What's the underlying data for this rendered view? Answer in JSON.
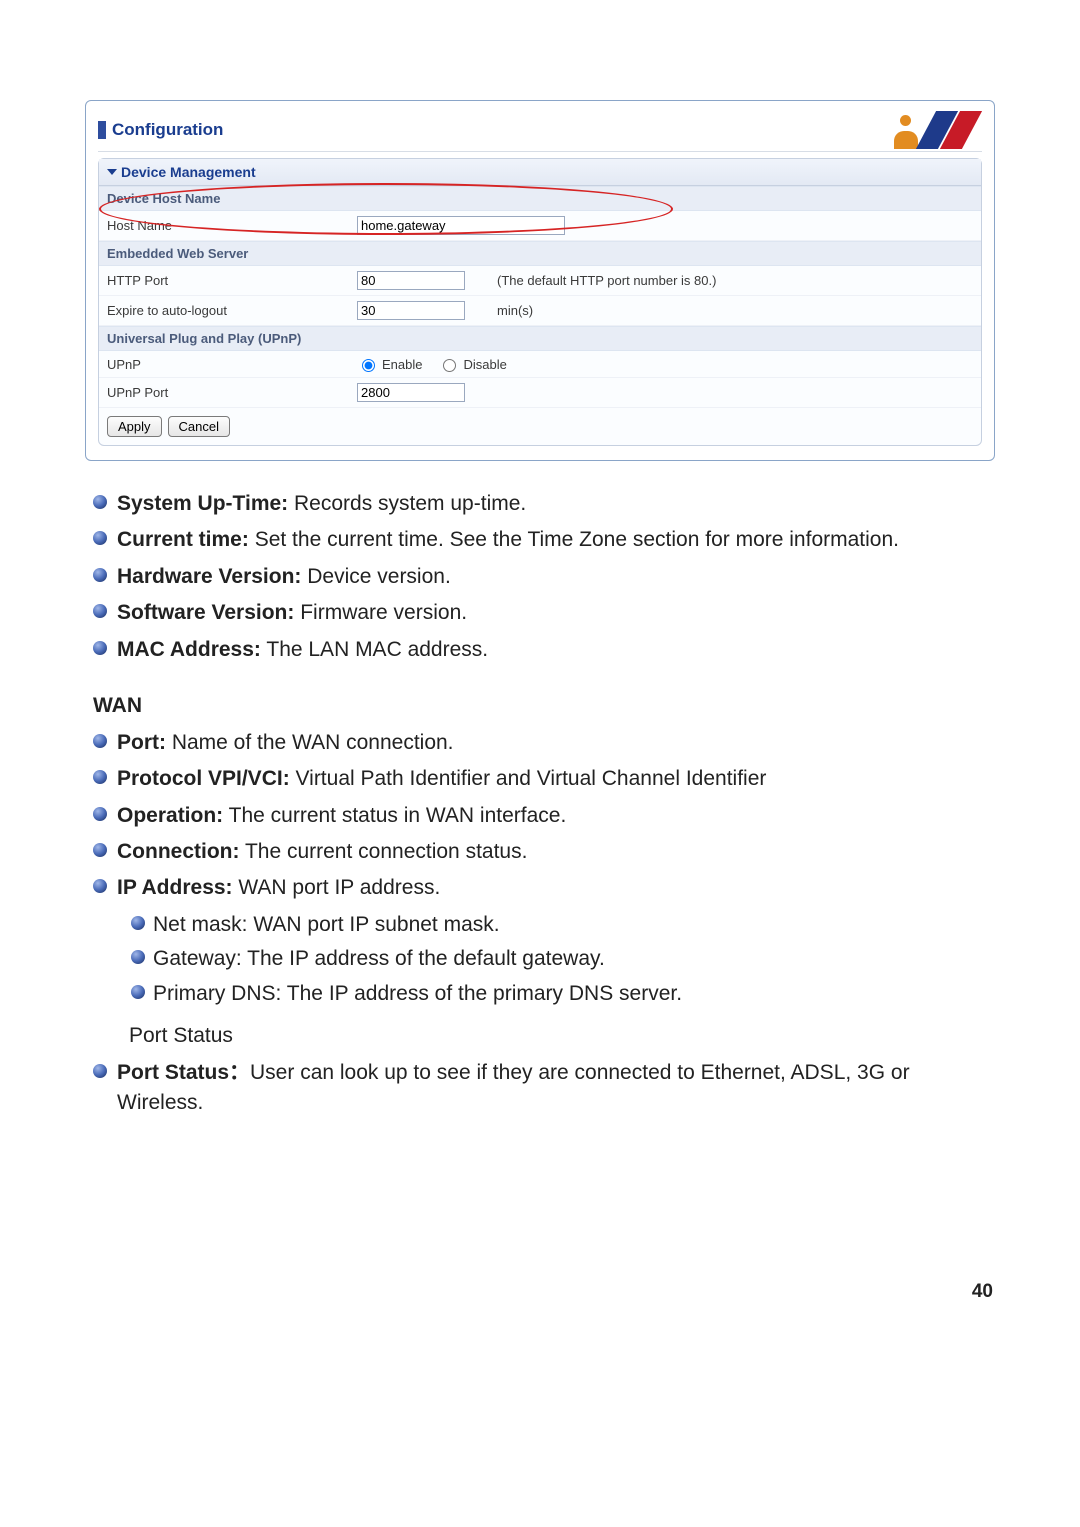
{
  "panel": {
    "title": "Configuration",
    "section": "Device Management",
    "sub1": "Device Host Name",
    "hostname_label": "Host Name",
    "hostname_value": "home.gateway",
    "sub2": "Embedded Web Server",
    "http_port_label": "HTTP Port",
    "http_port_value": "80",
    "http_port_hint": "(The default HTTP port number is 80.)",
    "expire_label": "Expire to auto-logout",
    "expire_value": "30",
    "expire_unit": "min(s)",
    "sub3": "Universal Plug and Play (UPnP)",
    "upnp_label": "UPnP",
    "upnp_enable": "Enable",
    "upnp_disable": "Disable",
    "upnp_port_label": "UPnP Port",
    "upnp_port_value": "2800",
    "apply": "Apply",
    "cancel": "Cancel"
  },
  "list1": [
    {
      "term": "System Up-Time:",
      "desc": " Records system up-time."
    },
    {
      "term": "Current time:",
      "desc": " Set the current time. See the Time Zone section for more information."
    },
    {
      "term": "Hardware Version:",
      "desc": " Device version."
    },
    {
      "term": "Software Version:",
      "desc": " Firmware version."
    },
    {
      "term": "MAC Address:",
      "desc": " The LAN MAC address."
    }
  ],
  "wan_heading": "WAN",
  "list2": [
    {
      "term": "Port:",
      "desc": " Name of the WAN connection."
    },
    {
      "term": "Protocol VPI/VCI:",
      "desc": " Virtual Path Identifier and Virtual Channel Identifier"
    },
    {
      "term": "Operation:",
      "desc": " The current status in WAN interface."
    },
    {
      "term": "Connection:",
      "desc": " The current connection status."
    },
    {
      "term": "IP Address:",
      "desc": "   WAN port IP address."
    }
  ],
  "sublist": [
    "Net mask: WAN port IP subnet mask.",
    "Gateway: The IP address of the default gateway.",
    "Primary DNS: The IP address of the primary DNS server."
  ],
  "port_status_line": "Port Status",
  "port_status_term": "Port Status：",
  "port_status_desc": "User can look up to see if they are connected to Ethernet, ADSL, 3G or Wireless.",
  "page_number": "40"
}
